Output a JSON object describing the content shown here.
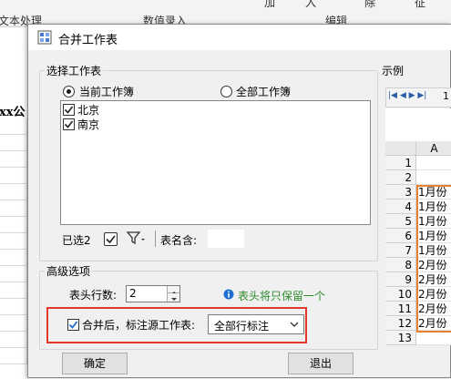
{
  "background": {
    "ribbon_groups": [
      "文本处理",
      "数值录入",
      "编辑"
    ],
    "ribbon_top_fragments": [
      "加",
      "入",
      "除",
      "征"
    ],
    "cell_fragment": "xx公"
  },
  "dialog": {
    "title": "合并工作表",
    "select_group": {
      "legend": "选择工作表",
      "radio_current": "当前工作簿",
      "radio_all": "全部工作簿",
      "radio_current_selected": true,
      "sheets": [
        {
          "name": "北京",
          "checked": true
        },
        {
          "name": "南京",
          "checked": true
        }
      ],
      "selected_count": "已选2",
      "sheet_name_label": "表名含:"
    },
    "advanced_group": {
      "legend": "高级选项",
      "header_rows_label": "表头行数:",
      "header_rows_value": "2",
      "hint": "表头将只保留一个",
      "mark_source_label": "合并后，标注源工作表:",
      "mark_source_checked": true,
      "mark_source_option": "全部行标注"
    },
    "ok_button": "确定",
    "exit_button": "退出",
    "example": {
      "legend": "示例",
      "nav": "|◀ ◀ ▶ ▶|",
      "tab": "1",
      "column_header": "A",
      "rows": [
        {
          "n": "1",
          "v": ""
        },
        {
          "n": "2",
          "v": ""
        },
        {
          "n": "3",
          "v": "1月份"
        },
        {
          "n": "4",
          "v": "1月份"
        },
        {
          "n": "5",
          "v": "1月份"
        },
        {
          "n": "6",
          "v": "1月份"
        },
        {
          "n": "7",
          "v": "1月份"
        },
        {
          "n": "8",
          "v": "2月份"
        },
        {
          "n": "9",
          "v": "2月份"
        },
        {
          "n": "10",
          "v": "2月份"
        },
        {
          "n": "11",
          "v": "2月份"
        },
        {
          "n": "12",
          "v": "2月份"
        },
        {
          "n": "13",
          "v": ""
        }
      ]
    }
  },
  "colors": {
    "highlight": "#e0392b",
    "orange_border": "#e8822e",
    "hint_green": "#2e8b2e",
    "info_blue": "#1e6fd0"
  }
}
